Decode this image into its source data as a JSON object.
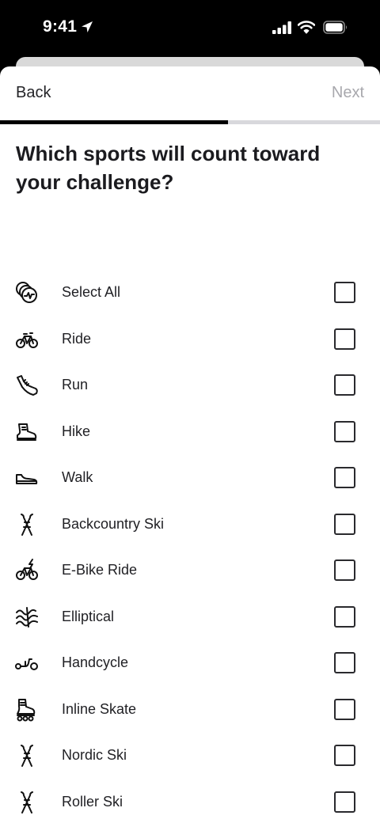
{
  "status_bar": {
    "time": "9:41"
  },
  "nav": {
    "back_label": "Back",
    "next_label": "Next"
  },
  "progress": {
    "fraction": 0.6
  },
  "question": {
    "text": "Which sports will count toward your challenge?"
  },
  "sports": [
    {
      "label": "Select All",
      "icon": "select-all-icon",
      "checked": false
    },
    {
      "label": "Ride",
      "icon": "bike-icon",
      "checked": false
    },
    {
      "label": "Run",
      "icon": "running-shoe-icon",
      "checked": false
    },
    {
      "label": "Hike",
      "icon": "hiking-boot-icon",
      "checked": false
    },
    {
      "label": "Walk",
      "icon": "walking-shoe-icon",
      "checked": false
    },
    {
      "label": "Backcountry Ski",
      "icon": "skis-icon",
      "checked": false
    },
    {
      "label": "E-Bike Ride",
      "icon": "ebike-icon",
      "checked": false
    },
    {
      "label": "Elliptical",
      "icon": "elliptical-icon",
      "checked": false
    },
    {
      "label": "Handcycle",
      "icon": "handcycle-icon",
      "checked": false
    },
    {
      "label": "Inline Skate",
      "icon": "inline-skate-icon",
      "checked": false
    },
    {
      "label": "Nordic Ski",
      "icon": "skis-icon",
      "checked": false
    },
    {
      "label": "Roller Ski",
      "icon": "skis-icon",
      "checked": false
    }
  ]
}
